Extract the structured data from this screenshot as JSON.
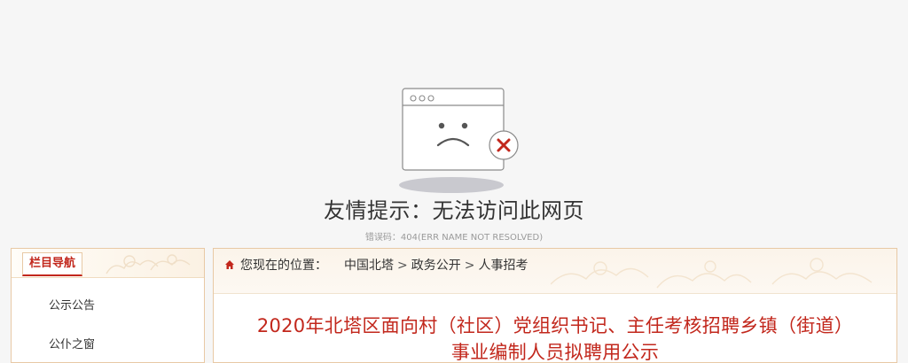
{
  "error": {
    "title": "友情提示：无法访问此网页",
    "code": "错误码：404(ERR NAME NOT RESOLVED)",
    "illustration_icon": "broken-page-sad-face-icon",
    "badge_icon": "close-icon",
    "accent": "#c2271c"
  },
  "sidebar": {
    "title": "栏目导航",
    "items": [
      {
        "label": "公示公告"
      },
      {
        "label": "公仆之窗"
      }
    ]
  },
  "breadcrumb": {
    "prefix": "您现在的位置：",
    "items": [
      "中国北塔",
      "政务公开",
      "人事招考"
    ],
    "separator": ">",
    "home_icon": "home-icon"
  },
  "article": {
    "title": "2020年北塔区面向村（社区）党组织书记、主任考核招聘乡镇（街道）事业编制人员拟聘用公示"
  },
  "colors": {
    "brand_red": "#c2271c",
    "border_tan": "#e8c9a5",
    "page_bg": "#f6f6f6"
  }
}
